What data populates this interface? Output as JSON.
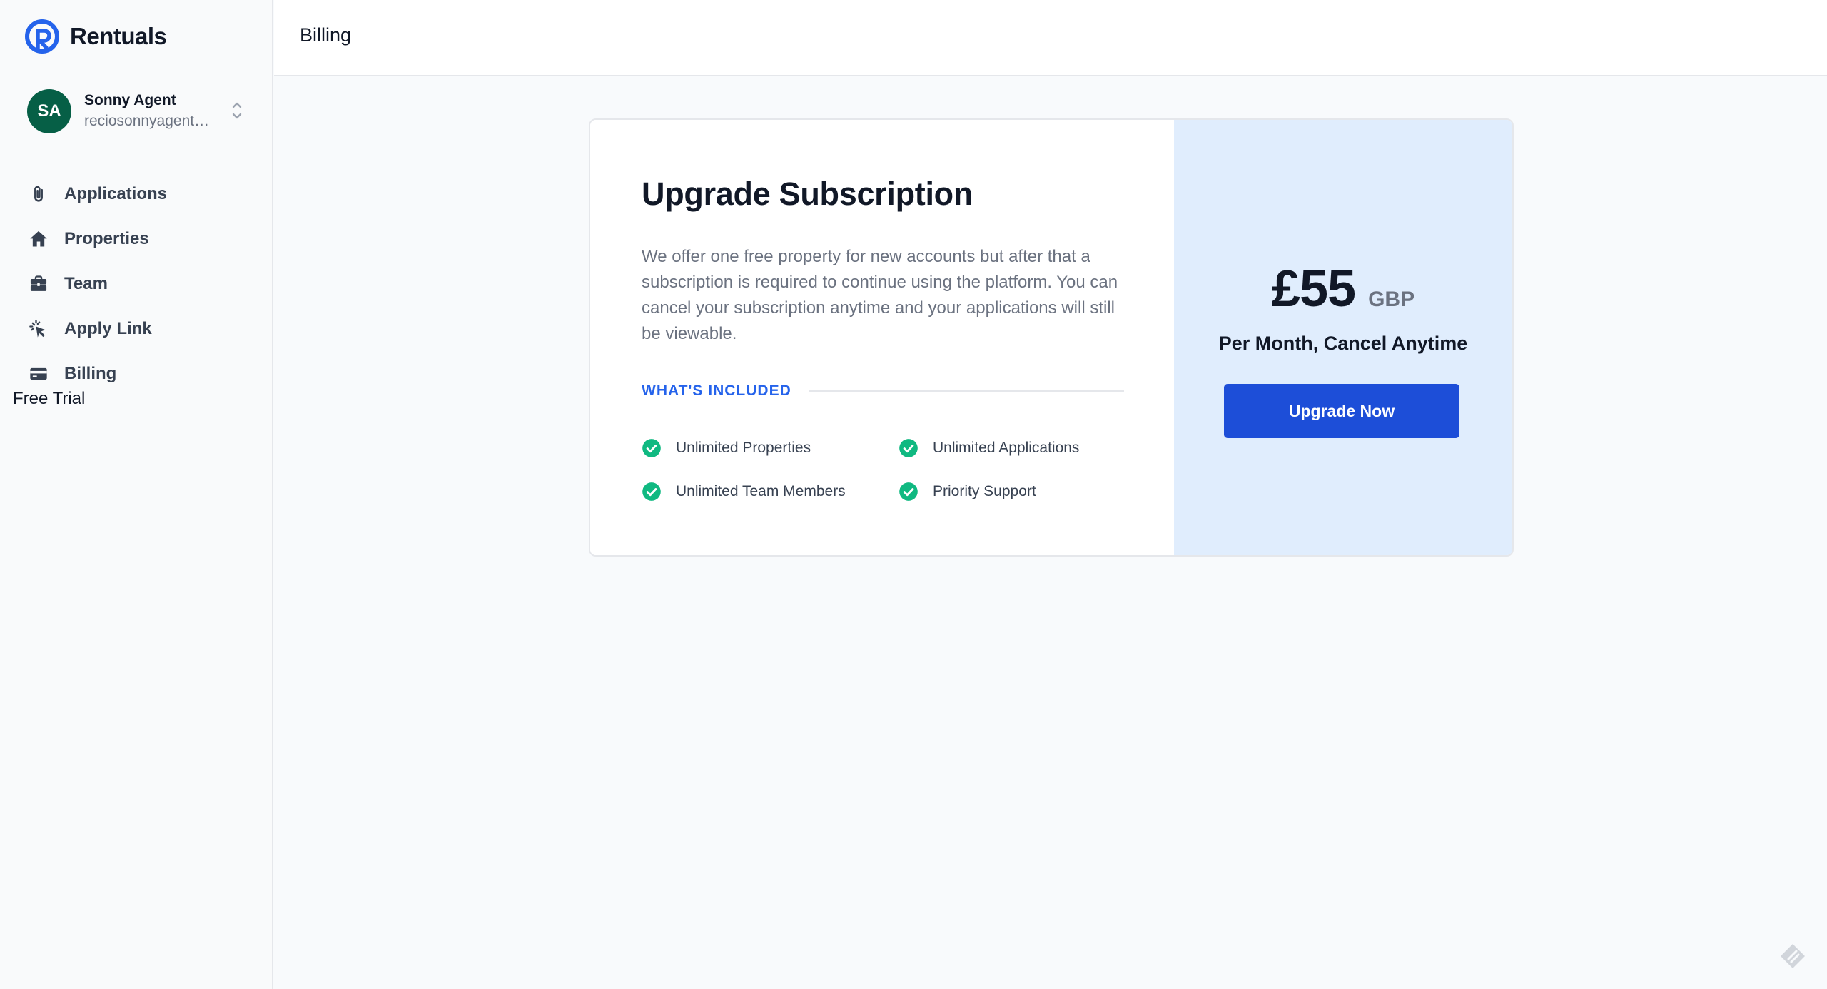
{
  "app": {
    "name": "Rentuals"
  },
  "user": {
    "initials": "SA",
    "name": "Sonny Agent",
    "email": "reciosonnyagent@..."
  },
  "sidebar": {
    "items": [
      {
        "label": "Applications",
        "icon": "paperclip-icon"
      },
      {
        "label": "Properties",
        "icon": "home-icon"
      },
      {
        "label": "Team",
        "icon": "briefcase-icon"
      },
      {
        "label": "Apply Link",
        "icon": "cursor-click-icon"
      },
      {
        "label": "Billing",
        "icon": "credit-card-icon"
      }
    ],
    "plan_status": "Free Trial"
  },
  "header": {
    "title": "Billing"
  },
  "subscription": {
    "title": "Upgrade Subscription",
    "description": "We offer one free property for new accounts but after that a subscription is required to continue using the platform. You can cancel your subscription anytime and your applications will still be viewable.",
    "included_label": "WHAT'S INCLUDED",
    "features": [
      "Unlimited Properties",
      "Unlimited Applications",
      "Unlimited Team Members",
      "Priority Support"
    ],
    "price": {
      "amount": "£55",
      "currency": "GBP",
      "terms": "Per Month, Cancel Anytime"
    },
    "cta_label": "Upgrade Now"
  },
  "colors": {
    "brand": "#2563eb",
    "button": "#1d4ed8",
    "avatar": "#065f46",
    "check": "#10b981",
    "price_panel": "#e0edfd"
  }
}
